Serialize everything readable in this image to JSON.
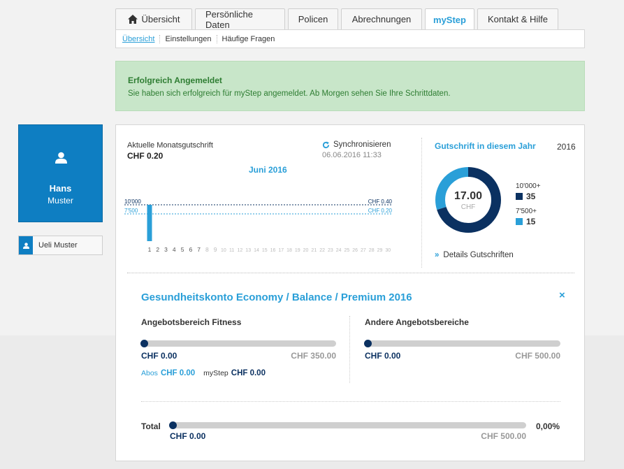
{
  "tabs": [
    {
      "label": "Übersicht",
      "active": false,
      "icon": "home-icon"
    },
    {
      "label": "Persönliche Daten",
      "active": false
    },
    {
      "label": "Policen",
      "active": false
    },
    {
      "label": "Abrechnungen",
      "active": false
    },
    {
      "label": "myStep",
      "active": true
    },
    {
      "label": "Kontakt & Hilfe",
      "active": false
    }
  ],
  "subnav": [
    {
      "label": "Übersicht",
      "active": true
    },
    {
      "label": "Einstellungen",
      "active": false
    },
    {
      "label": "Häufige Fragen",
      "active": false
    }
  ],
  "alert": {
    "title": "Erfolgreich Angemeldet",
    "text": "Sie haben sich erfolgreich für myStep angemeldet. Ab Morgen sehen Sie Ihre Schrittdaten."
  },
  "profile": {
    "first_name": "Hans",
    "last_name": "Muster",
    "icon": "user-icon"
  },
  "user_chip": {
    "label": "Ueli Muster",
    "icon": "user-icon"
  },
  "monthly": {
    "label": "Aktuelle Monatsgutschrift",
    "value": "CHF 0.20",
    "sync_label": "Synchronisieren",
    "sync_time": "06.06.2016 11:33",
    "chart_title": "Juni 2016"
  },
  "chart_data": {
    "type": "bar",
    "title": "Juni 2016",
    "categories": [
      "1",
      "2",
      "3",
      "4",
      "5",
      "6",
      "7",
      "8",
      "9",
      "10",
      "11",
      "12",
      "13",
      "14",
      "15",
      "16",
      "17",
      "18",
      "19",
      "20",
      "21",
      "22",
      "23",
      "24",
      "25",
      "26",
      "27",
      "28",
      "29",
      "30"
    ],
    "values": [
      10000,
      0,
      0,
      0,
      0,
      0,
      0,
      0,
      0,
      0,
      0,
      0,
      0,
      0,
      0,
      0,
      0,
      0,
      0,
      0,
      0,
      0,
      0,
      0,
      0,
      0,
      0,
      0,
      0,
      0
    ],
    "ylim": [
      0,
      10000
    ],
    "thresholds": [
      {
        "label": "10'000",
        "right_label": "CHF 0.40",
        "value": 10000,
        "color": "#0b3161"
      },
      {
        "label": "7'500",
        "right_label": "CHF 0.20",
        "value": 7500,
        "color": "#2a9fd8"
      }
    ],
    "colors": {
      "bar": "#2a9fd8",
      "past_tick": "#555555",
      "future_tick": "#bbbbbb"
    },
    "current_day": 7
  },
  "yearly": {
    "title": "Gutschrift in diesem Jahr",
    "year": "2016",
    "total": "17.00",
    "currency": "CHF",
    "segments": [
      {
        "label": "10'000+",
        "value": 35,
        "display": "35",
        "color": "#0b3161"
      },
      {
        "label": "7'500+",
        "value": 15,
        "display": "15",
        "color": "#2a9fd8"
      }
    ],
    "details_link": "Details Gutschriften"
  },
  "account": {
    "title": "Gesundheitskonto Economy / Balance / Premium 2016",
    "close_label": "×",
    "fitness": {
      "title": "Angebotsbereich Fitness",
      "current": "CHF 0.00",
      "max": "CHF 350.00",
      "progress": 0
    },
    "other": {
      "title": "Andere Angebotsbereiche",
      "current": "CHF 0.00",
      "max": "CHF 500.00",
      "progress": 0
    },
    "abos_label": "Abos",
    "abos_value": "CHF 0.00",
    "mystep_label": "myStep",
    "mystep_value": "CHF 0.00",
    "total": {
      "label": "Total",
      "current": "CHF 0.00",
      "max": "CHF 500.00",
      "percent": "0,00%",
      "progress": 0
    }
  },
  "colors": {
    "accent": "#2a9fd8",
    "dark": "#0b3161",
    "profile_bg": "#0e7ec2",
    "alert_bg": "#c8e6c9",
    "alert_text": "#2e7d32"
  }
}
